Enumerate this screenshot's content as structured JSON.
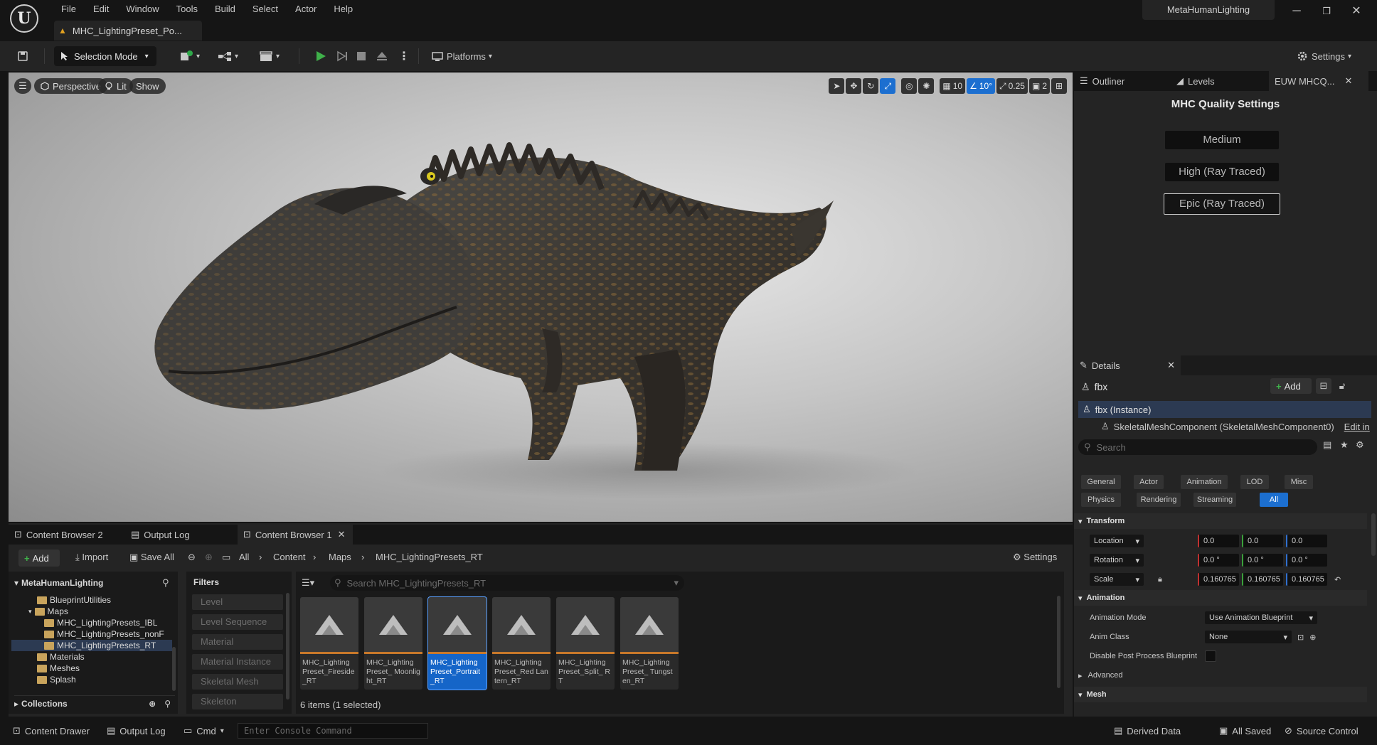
{
  "app": {
    "logo_letter": "U",
    "project_name": "MetaHumanLighting",
    "menu": [
      "File",
      "Edit",
      "Window",
      "Tools",
      "Build",
      "Select",
      "Actor",
      "Help"
    ],
    "document_tab": "MHC_LightingPreset_Po...",
    "window_controls": {
      "minimize": "─",
      "maximize": "❐",
      "close": "✕"
    }
  },
  "toolbar": {
    "selection_mode": "Selection Mode",
    "platforms": "Platforms",
    "settings": "Settings"
  },
  "viewport": {
    "perspective": "Perspective",
    "lit": "Lit",
    "show": "Show",
    "grid_snap": "10",
    "rotation_snap": "10°",
    "scale_snap": "0.25",
    "camera_speed": "2"
  },
  "right_tabs": {
    "outliner": "Outliner",
    "levels": "Levels",
    "euw": "EUW MHCQ..."
  },
  "mhc_quality": {
    "title": "MHC Quality Settings",
    "options": [
      "Medium",
      "High (Ray Traced)",
      "Epic (Ray Traced)"
    ],
    "selected": "Epic (Ray Traced)"
  },
  "details": {
    "tab_label": "Details",
    "actor_name": "fbx",
    "add_label": "Add",
    "instance_label": "fbx (Instance)",
    "component_label": "SkeletalMeshComponent (SkeletalMeshComponent0)",
    "edit_in_label": "Edit in",
    "search_placeholder": "Search",
    "filters_row1": [
      "General",
      "Actor",
      "Animation",
      "LOD",
      "Misc"
    ],
    "filters_row2": [
      "Physics",
      "Rendering",
      "Streaming",
      "All"
    ],
    "active_filter": "All",
    "transform": {
      "header": "Transform",
      "location_label": "Location",
      "location": [
        "0.0",
        "0.0",
        "0.0"
      ],
      "rotation_label": "Rotation",
      "rotation": [
        "0.0 °",
        "0.0 °",
        "0.0 °"
      ],
      "scale_label": "Scale",
      "scale": [
        "0.160765",
        "0.160765",
        "0.160765"
      ]
    },
    "animation": {
      "header": "Animation",
      "mode_label": "Animation Mode",
      "mode_value": "Use Animation Blueprint",
      "class_label": "Anim Class",
      "class_value": "None",
      "disable_pp_label": "Disable Post Process Blueprint"
    },
    "advanced_label": "Advanced",
    "mesh_header": "Mesh"
  },
  "bottom_tabs": {
    "cb2": "Content Browser 2",
    "output_log": "Output Log",
    "cb1": "Content Browser 1"
  },
  "content_browser": {
    "add": "Add",
    "import": "Import",
    "save_all": "Save All",
    "breadcrumb": [
      "All",
      "Content",
      "Maps",
      "MHC_LightingPresets_RT"
    ],
    "settings": "Settings",
    "tree_root": "MetaHumanLighting",
    "tree": [
      {
        "label": "BlueprintUtilities",
        "depth": 1
      },
      {
        "label": "Maps",
        "depth": 1
      },
      {
        "label": "MHC_LightingPresets_IBL",
        "depth": 2
      },
      {
        "label": "MHC_LightingPresets_nonF",
        "depth": 2
      },
      {
        "label": "MHC_LightingPresets_RT",
        "depth": 2
      },
      {
        "label": "Materials",
        "depth": 1
      },
      {
        "label": "Meshes",
        "depth": 1
      },
      {
        "label": "Splash",
        "depth": 1
      }
    ],
    "collections": "Collections",
    "filters_header": "Filters",
    "filters": [
      "Level",
      "Level Sequence",
      "Material",
      "Material Instance",
      "Skeletal Mesh",
      "Skeleton"
    ],
    "search_placeholder": "Search MHC_LightingPresets_RT",
    "assets": [
      "MHC_Lighting Preset_Fireside _RT",
      "MHC_Lighting Preset_ Moonlight_RT",
      "MHC_Lighting Preset_Portrait _RT",
      "MHC_Lighting Preset_Red Lantern_RT",
      "MHC_Lighting Preset_Split_ RT",
      "MHC_Lighting Preset_ Tungsten_RT"
    ],
    "selected_asset_index": 2,
    "item_count": "6 items (1 selected)"
  },
  "statusbar": {
    "content_drawer": "Content Drawer",
    "output_log": "Output Log",
    "cmd": "Cmd",
    "console_placeholder": "Enter Console Command",
    "derived_data": "Derived Data",
    "all_saved": "All Saved",
    "source_control": "Source Control"
  }
}
